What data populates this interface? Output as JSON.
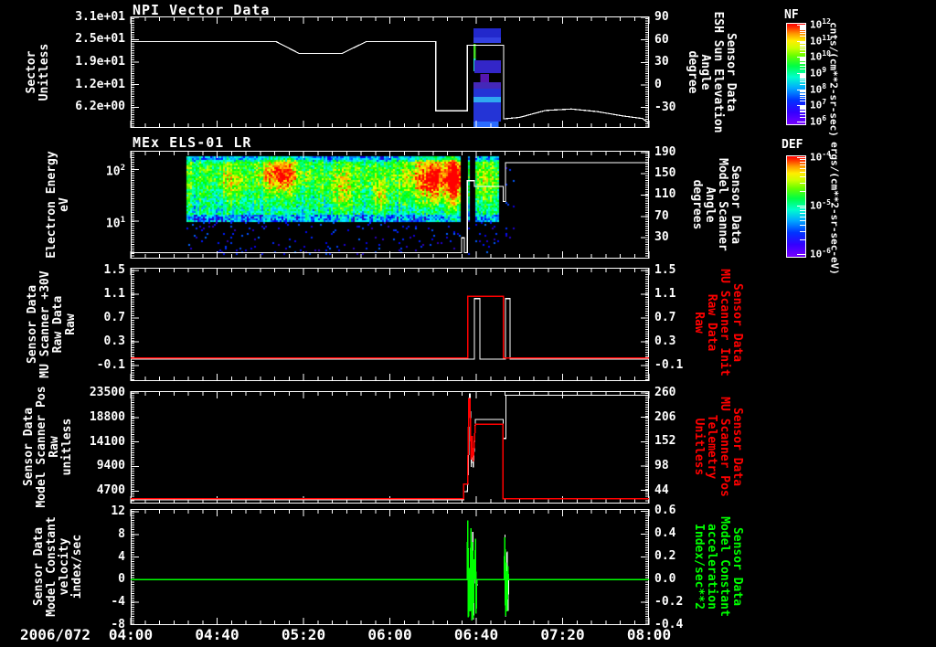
{
  "xaxis": {
    "date_label": "2006/072",
    "tick_labels": [
      "04:00",
      "04:40",
      "05:20",
      "06:00",
      "06:40",
      "07:20",
      "08:00"
    ],
    "t_start": 4.0,
    "t_end": 8.0
  },
  "colorbars": [
    {
      "label": "NF",
      "unit": "cnts/(cm**2-sr-sec)",
      "tick_base": "10",
      "tick_exponents": [
        "12",
        "11",
        "10",
        "9",
        "8",
        "7",
        "6"
      ]
    },
    {
      "label": "DEF",
      "unit": "ergs/(cm**2-sr-sec-eV)",
      "tick_base": "10",
      "tick_exponents": [
        "-4",
        "-5",
        "-6"
      ]
    }
  ],
  "chart_data": [
    {
      "type": "line",
      "title": "NPI Vector Data",
      "left_label": [
        "Sector",
        "Unitless"
      ],
      "right_label": [
        "Sensor Data",
        "ESH Sun Elevation",
        "Angle",
        "degree"
      ],
      "right_label_color": "#ffffff",
      "left_ticks": [
        {
          "v": 31.0,
          "label": "3.1e+01"
        },
        {
          "v": 24.8,
          "label": "2.5e+01"
        },
        {
          "v": 18.6,
          "label": "1.9e+01"
        },
        {
          "v": 12.4,
          "label": "1.2e+01"
        },
        {
          "v": 6.2,
          "label": "6.2e+00"
        }
      ],
      "right_ticks": [
        {
          "v": 90,
          "label": "90"
        },
        {
          "v": 60,
          "label": "60"
        },
        {
          "v": 30,
          "label": "30"
        },
        {
          "v": 0,
          "label": "0"
        },
        {
          "v": -30,
          "label": "-30"
        }
      ],
      "ylim_left": [
        0.5,
        31.2
      ],
      "ylim_right": [
        -57,
        91
      ],
      "series": [
        {
          "name": "sector",
          "color": "#ffffff",
          "axis": "left",
          "points": [
            [
              4.0,
              24.3
            ],
            [
              5.12,
              24.3
            ],
            [
              5.3,
              21.0
            ],
            [
              5.63,
              21.0
            ],
            [
              5.82,
              24.3
            ],
            [
              6.355,
              24.3
            ],
            [
              6.355,
              5.2
            ],
            [
              6.598,
              5.2
            ],
            [
              6.598,
              23.3
            ],
            [
              6.878,
              23.3
            ],
            [
              6.878,
              3.0
            ],
            [
              7.0,
              3.4
            ],
            [
              7.2,
              5.3
            ],
            [
              7.4,
              5.7
            ],
            [
              7.6,
              5.0
            ],
            [
              7.8,
              3.8
            ],
            [
              7.95,
              3.1
            ],
            [
              8.0,
              1.8
            ]
          ]
        }
      ],
      "event_blocks": [
        {
          "t0": 6.645,
          "t1": 6.857,
          "f0": 0.107,
          "f1": 0.189,
          "color": "#2228cc"
        },
        {
          "t0": 6.645,
          "t1": 6.857,
          "f0": 0.189,
          "f1": 0.238,
          "color": "#3340e0"
        },
        {
          "t0": 6.645,
          "t1": 6.664,
          "f0": 0.246,
          "f1": 0.377,
          "color": "#44dd22"
        },
        {
          "t0": 6.645,
          "t1": 6.664,
          "f0": 0.377,
          "f1": 0.492,
          "color": "#22ddcc"
        },
        {
          "t0": 6.652,
          "t1": 6.857,
          "f0": 0.393,
          "f1": 0.508,
          "color": "#3326c8"
        },
        {
          "t0": 6.7,
          "t1": 6.765,
          "f0": 0.516,
          "f1": 0.59,
          "color": "#5516b0"
        },
        {
          "t0": 6.645,
          "t1": 6.857,
          "f0": 0.59,
          "f1": 0.648,
          "color": "#4428b8"
        },
        {
          "t0": 6.645,
          "t1": 6.857,
          "f0": 0.648,
          "f1": 0.721,
          "color": "#2434d6"
        },
        {
          "t0": 6.645,
          "t1": 6.857,
          "f0": 0.721,
          "f1": 0.77,
          "color": "#2fa8f0"
        },
        {
          "t0": 6.645,
          "t1": 6.857,
          "f0": 0.77,
          "f1": 0.943,
          "color": "#2434d6"
        },
        {
          "t0": 6.645,
          "t1": 6.838,
          "f0": 0.943,
          "f1": 1.0,
          "color": "#2a6cff"
        }
      ]
    },
    {
      "type": "heatmap",
      "title": "MEx ELS-01 LR",
      "left_label": [
        "Electron Energy",
        "eV"
      ],
      "right_label": [
        "Sensor Data",
        "Model Scanner",
        "Angle",
        "degrees"
      ],
      "right_label_color": "#ffffff",
      "left_ticks": [
        {
          "v": 100,
          "label": "10",
          "sup": "2"
        },
        {
          "v": 10,
          "label": "10",
          "sup": "1"
        }
      ],
      "right_ticks": [
        {
          "v": 190,
          "label": "190"
        },
        {
          "v": 150,
          "label": "150"
        },
        {
          "v": 110,
          "label": "110"
        },
        {
          "v": 70,
          "label": "70"
        },
        {
          "v": 30,
          "label": "30"
        }
      ],
      "ylim_left": [
        1.9,
        230
      ],
      "yscale_left": "log",
      "ylim_right": [
        -9,
        193
      ],
      "spectrogram": {
        "t_ranges": [
          [
            4.43,
            6.545
          ],
          [
            6.603,
            6.617
          ],
          [
            6.659,
            6.838
          ]
        ],
        "dot_ranges": [
          [
            6.88,
            6.96
          ]
        ],
        "band_top_frac": 0.05,
        "band_bottom_frac": 0.66,
        "hot_spots": [
          {
            "t": 5.15,
            "f": 0.2,
            "tw": 0.13,
            "fw": 0.18,
            "amp": 0.45
          },
          {
            "t": 6.33,
            "f": 0.25,
            "tw": 0.17,
            "fw": 0.22,
            "amp": 0.52
          },
          {
            "t": 6.5,
            "f": 0.28,
            "tw": 0.05,
            "fw": 0.3,
            "amp": 0.45
          },
          {
            "t": 5.62,
            "f": 0.38,
            "tw": 0.1,
            "fw": 0.2,
            "amp": 0.25
          },
          {
            "t": 5.93,
            "f": 0.42,
            "tw": 0.05,
            "fw": 0.18,
            "amp": 0.35
          },
          {
            "t": 4.78,
            "f": 0.3,
            "tw": 0.08,
            "fw": 0.2,
            "amp": 0.22
          },
          {
            "t": 6.72,
            "f": 0.3,
            "tw": 0.06,
            "fw": 0.25,
            "amp": 0.18
          }
        ],
        "seed": 20060721
      },
      "series": [
        {
          "name": "scanner-angle",
          "color": "#ffffff",
          "axis": "right",
          "points": [
            [
              4.0,
              2
            ],
            [
              6.553,
              2
            ],
            [
              6.553,
              30
            ],
            [
              6.575,
              30
            ],
            [
              6.575,
              2
            ],
            [
              6.598,
              2
            ],
            [
              6.598,
              137
            ],
            [
              6.652,
              137
            ],
            [
              6.652,
              126
            ],
            [
              6.875,
              126
            ],
            [
              6.875,
              98
            ],
            [
              6.892,
              98
            ],
            [
              6.892,
              171
            ],
            [
              8.0,
              171
            ]
          ]
        }
      ]
    },
    {
      "type": "line",
      "title": "",
      "left_label": [
        "Sensor Data",
        "MU Scanner +30V",
        "Raw Data",
        "Raw"
      ],
      "right_label": [
        "Sensor Data",
        "MU Scanner Init",
        "Raw Data",
        "Raw"
      ],
      "right_label_color": "#ff0000",
      "left_ticks": [
        {
          "v": 1.5,
          "label": "1.5"
        },
        {
          "v": 1.1,
          "label": "1.1"
        },
        {
          "v": 0.7,
          "label": "0.7"
        },
        {
          "v": 0.3,
          "label": "0.3"
        },
        {
          "v": -0.1,
          "label": "-0.1"
        }
      ],
      "right_ticks": [
        {
          "v": 1.5,
          "label": "1.5"
        },
        {
          "v": 1.1,
          "label": "1.1"
        },
        {
          "v": 0.7,
          "label": "0.7"
        },
        {
          "v": 0.3,
          "label": "0.3"
        },
        {
          "v": -0.1,
          "label": "-0.1"
        }
      ],
      "ylim_left": [
        -0.36,
        1.55
      ],
      "ylim_right": [
        -0.36,
        1.55
      ],
      "series": [
        {
          "name": "scanner-30v-raw",
          "color": "#ffffff",
          "axis": "left",
          "points": [
            [
              4.0,
              0.01
            ],
            [
              6.652,
              0.01
            ],
            [
              6.652,
              1.03
            ],
            [
              6.695,
              1.03
            ],
            [
              6.695,
              0.01
            ],
            [
              6.893,
              0.01
            ],
            [
              6.893,
              1.03
            ],
            [
              6.928,
              1.03
            ],
            [
              6.928,
              0.01
            ],
            [
              8.0,
              0.01
            ]
          ]
        },
        {
          "name": "scanner-init-raw",
          "color": "#ff0000",
          "axis": "right",
          "points": [
            [
              4.0,
              0.03
            ],
            [
              6.6,
              0.03
            ],
            [
              6.6,
              1.07
            ],
            [
              6.875,
              1.07
            ],
            [
              6.875,
              0.03
            ],
            [
              8.0,
              0.03
            ]
          ]
        }
      ]
    },
    {
      "type": "line",
      "title": "",
      "left_label": [
        "Sensor Data",
        "Model Scanner Pos",
        "Raw",
        "unitless"
      ],
      "right_label": [
        "Sensor Data",
        "MU Scanner Pos",
        "Telemetry",
        "Unitless"
      ],
      "right_label_color": "#ff0000",
      "left_ticks": [
        {
          "v": 23500,
          "label": "23500"
        },
        {
          "v": 18800,
          "label": "18800"
        },
        {
          "v": 14100,
          "label": "14100"
        },
        {
          "v": 9400,
          "label": "9400"
        },
        {
          "v": 4700,
          "label": "4700"
        }
      ],
      "right_ticks": [
        {
          "v": 260,
          "label": "260"
        },
        {
          "v": 206,
          "label": "206"
        },
        {
          "v": 152,
          "label": "152"
        },
        {
          "v": 98,
          "label": "98"
        },
        {
          "v": 44,
          "label": "44"
        }
      ],
      "ylim_left": [
        2300,
        23850
      ],
      "ylim_right": [
        15,
        264
      ],
      "series": [
        {
          "name": "model-scanner-pos",
          "color": "#ffffff",
          "axis": "left",
          "points": [
            [
              4.0,
              3050
            ],
            [
              6.572,
              3050
            ],
            [
              6.572,
              4600
            ],
            [
              6.598,
              4600
            ],
            [
              6.607,
              9000
            ],
            [
              6.613,
              23300
            ],
            [
              6.62,
              23300
            ],
            [
              6.628,
              9300
            ],
            [
              6.636,
              14800
            ],
            [
              6.644,
              9200
            ],
            [
              6.652,
              13000
            ],
            [
              6.66,
              18400
            ],
            [
              6.875,
              18400
            ],
            [
              6.875,
              14800
            ],
            [
              6.896,
              14800
            ],
            [
              6.896,
              23050
            ],
            [
              8.0,
              23050
            ]
          ]
        },
        {
          "name": "mu-scanner-pos-telemetry",
          "color": "#ff0000",
          "axis": "right",
          "points": [
            [
              4.0,
              26
            ],
            [
              6.568,
              26
            ],
            [
              6.568,
              58
            ],
            [
              6.6,
              58
            ],
            [
              6.61,
              247
            ],
            [
              6.618,
              247
            ],
            [
              6.627,
              112
            ],
            [
              6.635,
              165
            ],
            [
              6.643,
              108
            ],
            [
              6.652,
              150
            ],
            [
              6.66,
              191
            ],
            [
              6.873,
              191
            ],
            [
              6.873,
              26
            ],
            [
              8.0,
              26
            ]
          ]
        }
      ]
    },
    {
      "type": "line",
      "title": "",
      "left_label": [
        "Sensor Data",
        "Model Constant",
        "velocity",
        "index/sec"
      ],
      "right_label": [
        "Sensor Data",
        "Model Constant",
        "acceleration",
        "Index/sec**2"
      ],
      "right_label_color": "#00ff00",
      "left_ticks": [
        {
          "v": 12,
          "label": "12"
        },
        {
          "v": 8,
          "label": "8"
        },
        {
          "v": 4,
          "label": "4"
        },
        {
          "v": 0,
          "label": "0"
        },
        {
          "v": -4,
          "label": "-4"
        },
        {
          "v": -8,
          "label": "-8"
        }
      ],
      "right_ticks": [
        {
          "v": 0.6,
          "label": "0.6"
        },
        {
          "v": 0.4,
          "label": "0.4"
        },
        {
          "v": 0.2,
          "label": "0.2"
        },
        {
          "v": 0.0,
          "label": "0.0"
        },
        {
          "v": -0.2,
          "label": "-0.2"
        },
        {
          "v": -0.4,
          "label": "-0.4"
        }
      ],
      "ylim_left": [
        -8,
        12.5
      ],
      "ylim_right": [
        -0.4,
        0.62
      ],
      "series": [
        {
          "name": "model-constant-velocity",
          "color": "#ffffff",
          "axis": "left",
          "points": [
            [
              4.0,
              0.05
            ],
            [
              6.598,
              0.05
            ],
            [
              6.604,
              6.5
            ],
            [
              6.609,
              -5.5
            ],
            [
              6.614,
              0.3
            ],
            [
              6.622,
              -3
            ],
            [
              6.628,
              3.5
            ],
            [
              6.634,
              -6
            ],
            [
              6.64,
              8.5
            ],
            [
              6.646,
              -7
            ],
            [
              6.652,
              2
            ],
            [
              6.658,
              0.05
            ],
            [
              6.662,
              7
            ],
            [
              6.667,
              -6
            ],
            [
              6.672,
              0.05
            ],
            [
              6.883,
              0.05
            ],
            [
              6.889,
              8
            ],
            [
              6.894,
              -6.5
            ],
            [
              6.899,
              0.3
            ],
            [
              6.906,
              5
            ],
            [
              6.912,
              -5.5
            ],
            [
              6.917,
              0.05
            ],
            [
              8.0,
              0.05
            ]
          ]
        },
        {
          "name": "model-constant-acceleration",
          "color": "#00ff00",
          "axis": "right",
          "points": [
            [
              4.0,
              0.0
            ],
            [
              6.596,
              0.0
            ],
            [
              6.602,
              0.52
            ],
            [
              6.607,
              -0.33
            ],
            [
              6.612,
              0.1
            ],
            [
              6.62,
              -0.28
            ],
            [
              6.626,
              0.45
            ],
            [
              6.632,
              -0.36
            ],
            [
              6.638,
              0.33
            ],
            [
              6.644,
              -0.34
            ],
            [
              6.65,
              0.18
            ],
            [
              6.656,
              0.0
            ],
            [
              6.661,
              0.36
            ],
            [
              6.666,
              -0.3
            ],
            [
              6.671,
              0.0
            ],
            [
              6.882,
              0.0
            ],
            [
              6.888,
              0.37
            ],
            [
              6.893,
              -0.32
            ],
            [
              6.898,
              0.15
            ],
            [
              6.905,
              -0.28
            ],
            [
              6.911,
              0.12
            ],
            [
              6.916,
              0.0
            ],
            [
              8.0,
              0.0
            ]
          ]
        }
      ]
    }
  ]
}
